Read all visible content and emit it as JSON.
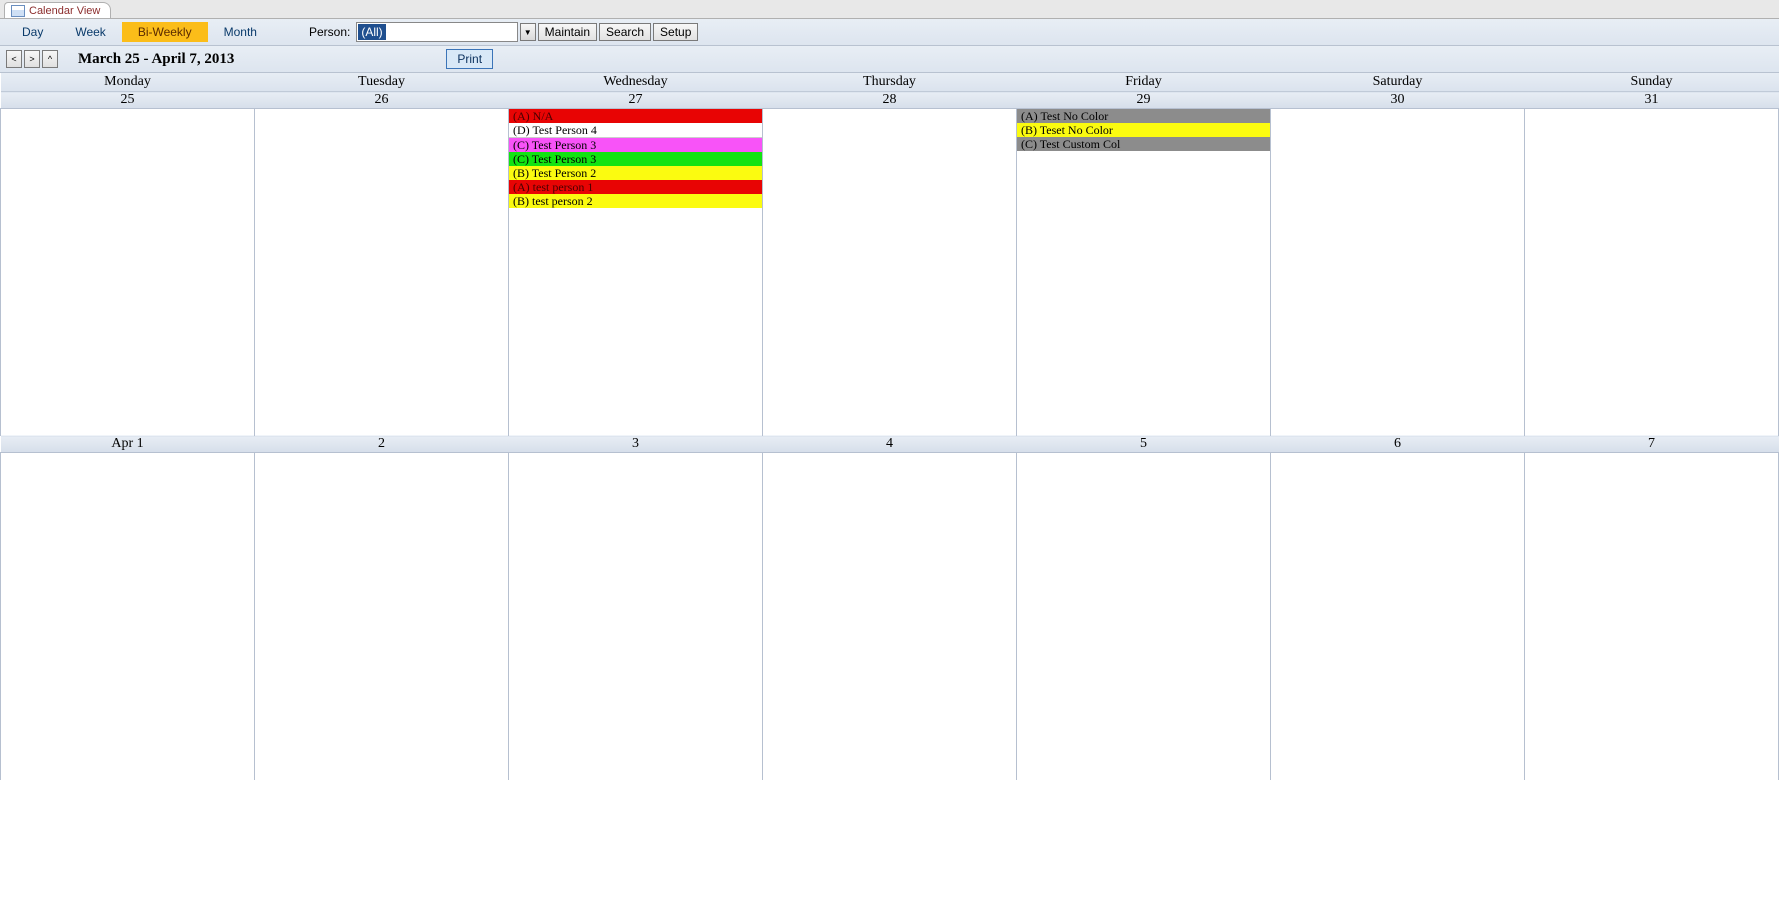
{
  "tab_title": "Calendar View",
  "toolbar": {
    "views": {
      "day": "Day",
      "week": "Week",
      "biweekly": "Bi-Weekly",
      "month": "Month"
    },
    "person_label": "Person:",
    "person_value": "(All)",
    "maintain": "Maintain",
    "search": "Search",
    "setup": "Setup"
  },
  "nav": {
    "prev": "<",
    "next": ">",
    "up": "^",
    "range": "March 25 - April 7, 2013",
    "print": "Print"
  },
  "dow": [
    "Monday",
    "Tuesday",
    "Wednesday",
    "Thursday",
    "Friday",
    "Saturday",
    "Sunday"
  ],
  "week1_dates": [
    "25",
    "26",
    "27",
    "28",
    "29",
    "30",
    "31"
  ],
  "week2_dates": [
    "Apr 1",
    "2",
    "3",
    "4",
    "5",
    "6",
    "7"
  ],
  "wed_events": [
    {
      "label": "(A) N/A",
      "color": "red"
    },
    {
      "label": "(D) Test Person 4",
      "color": "white"
    },
    {
      "label": "(C) Test Person 3",
      "color": "magenta"
    },
    {
      "label": "(C) Test Person 3",
      "color": "green"
    },
    {
      "label": "(B) Test Person 2",
      "color": "yellow"
    },
    {
      "label": "(A) test person 1",
      "color": "red"
    },
    {
      "label": "(B) test person 2",
      "color": "yellow"
    }
  ],
  "fri_events": [
    {
      "label": "(A) Test No Color",
      "color": "gray"
    },
    {
      "label": "(B) Teset No Color",
      "color": "yellow"
    },
    {
      "label": "(C) Test Custom Col",
      "color": "gray"
    }
  ]
}
